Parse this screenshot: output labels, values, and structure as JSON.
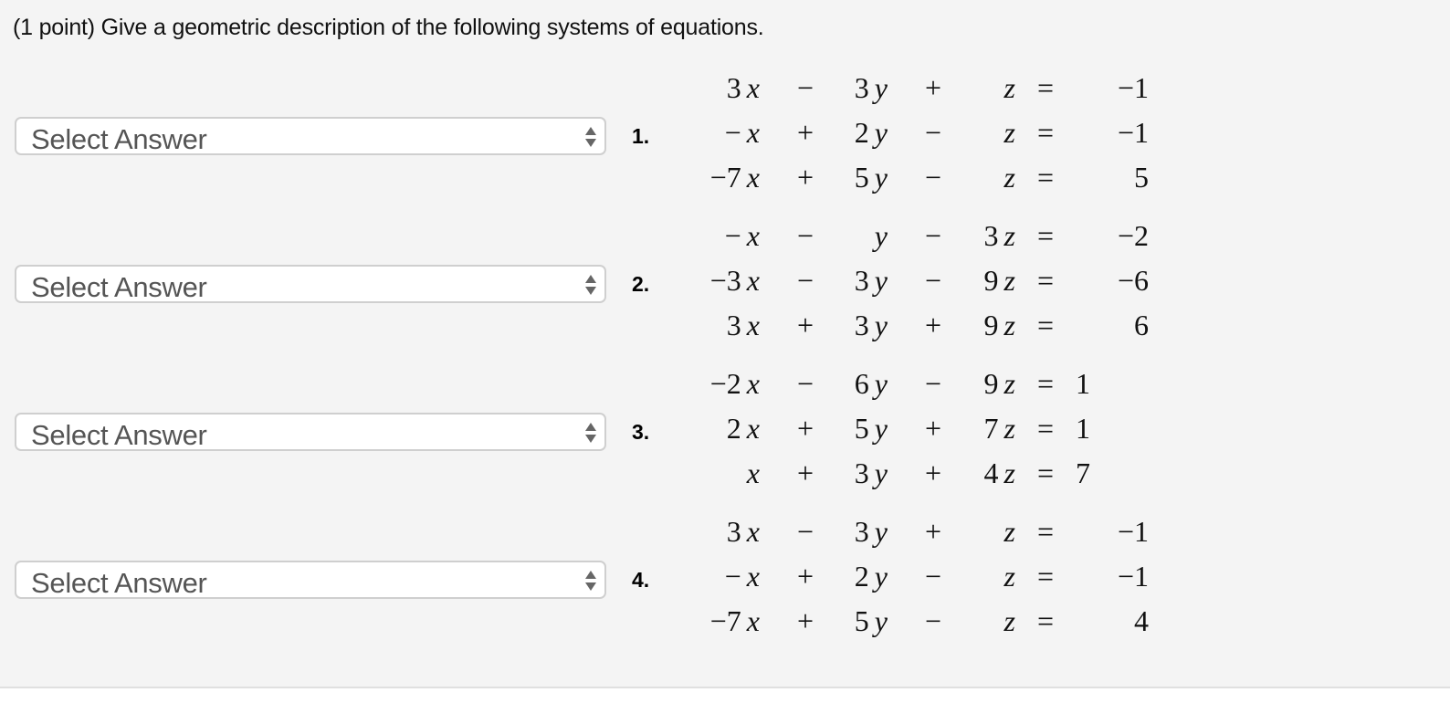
{
  "prompt": "(1 point) Give a geometric description of the following systems of equations.",
  "select_placeholder": "Select Answer",
  "problems": [
    {
      "number": "1.",
      "answer": "Select Answer",
      "rows": [
        {
          "a": "3",
          "op1": "−",
          "b": "3",
          "op2": "+",
          "c": "",
          "eq": "=",
          "rhs": "−1"
        },
        {
          "a": "−",
          "op1": "+",
          "b": "2",
          "op2": "−",
          "c": "",
          "eq": "=",
          "rhs": "−1"
        },
        {
          "a": "−7",
          "op1": "+",
          "b": "5",
          "op2": "−",
          "c": "",
          "eq": "=",
          "rhs": "5"
        }
      ]
    },
    {
      "number": "2.",
      "answer": "Select Answer",
      "rows": [
        {
          "a": "−",
          "op1": "−",
          "b": "",
          "op2": "−",
          "c": "3",
          "eq": "=",
          "rhs": "−2"
        },
        {
          "a": "−3",
          "op1": "−",
          "b": "3",
          "op2": "−",
          "c": "9",
          "eq": "=",
          "rhs": "−6"
        },
        {
          "a": "3",
          "op1": "+",
          "b": "3",
          "op2": "+",
          "c": "9",
          "eq": "=",
          "rhs": "6"
        }
      ]
    },
    {
      "number": "3.",
      "answer": "Select Answer",
      "rows": [
        {
          "a": "−2",
          "op1": "−",
          "b": "6",
          "op2": "−",
          "c": "9",
          "eq": "=",
          "rhs": "1"
        },
        {
          "a": "2",
          "op1": "+",
          "b": "5",
          "op2": "+",
          "c": "7",
          "eq": "=",
          "rhs": "1"
        },
        {
          "a": "",
          "op1": "+",
          "b": "3",
          "op2": "+",
          "c": "4",
          "eq": "=",
          "rhs": "7"
        }
      ]
    },
    {
      "number": "4.",
      "answer": "Select Answer",
      "rows": [
        {
          "a": "3",
          "op1": "−",
          "b": "3",
          "op2": "+",
          "c": "",
          "eq": "=",
          "rhs": "−1"
        },
        {
          "a": "−",
          "op1": "+",
          "b": "2",
          "op2": "−",
          "c": "",
          "eq": "=",
          "rhs": "−1"
        },
        {
          "a": "−7",
          "op1": "+",
          "b": "5",
          "op2": "−",
          "c": "",
          "eq": "=",
          "rhs": "4"
        }
      ]
    }
  ],
  "variables": {
    "x": "x",
    "y": "y",
    "z": "z"
  },
  "icons": {
    "select_arrows": "up-down-arrows-icon"
  }
}
